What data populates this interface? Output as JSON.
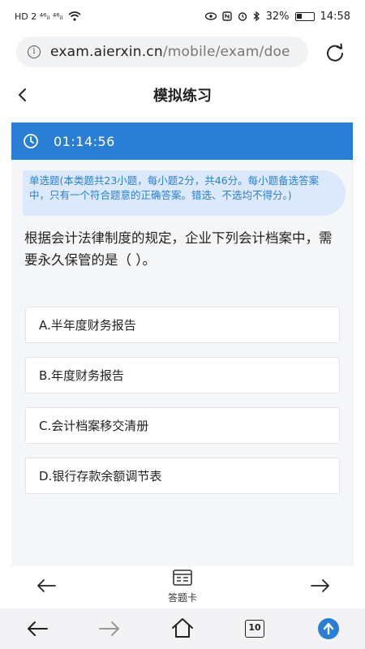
{
  "status_bar": {
    "left_indicators": "HD 2 ⁴⁶ᵢₗ ⁴⁶ᵢₗ",
    "battery": "32%",
    "time": "14:58"
  },
  "browser": {
    "url_domain": "exam.aierxin.cn",
    "url_path": "/mobile/exam/doe"
  },
  "header": {
    "title": "模拟练习"
  },
  "timer": {
    "value": "01:14:56"
  },
  "instructions": "单选题(本类题共23小题，每小题2分，共46分。每小题备选答案中，只有一个符合题意的正确答案。错选、不选均不得分。)",
  "question": "根据会计法律制度的规定，企业下列会计档案中，需要永久保管的是（ ）。",
  "options": [
    {
      "label": "A.半年度财务报告"
    },
    {
      "label": "B.年度财务报告"
    },
    {
      "label": "C.会计档案移交清册"
    },
    {
      "label": "D.银行存款余额调节表"
    }
  ],
  "bottom_nav": {
    "card_label": "答题卡"
  },
  "browser_bar": {
    "tab_count": "10"
  },
  "colors": {
    "accent": "#2a7fd4",
    "instruction_bg": "#dbe9fb"
  }
}
